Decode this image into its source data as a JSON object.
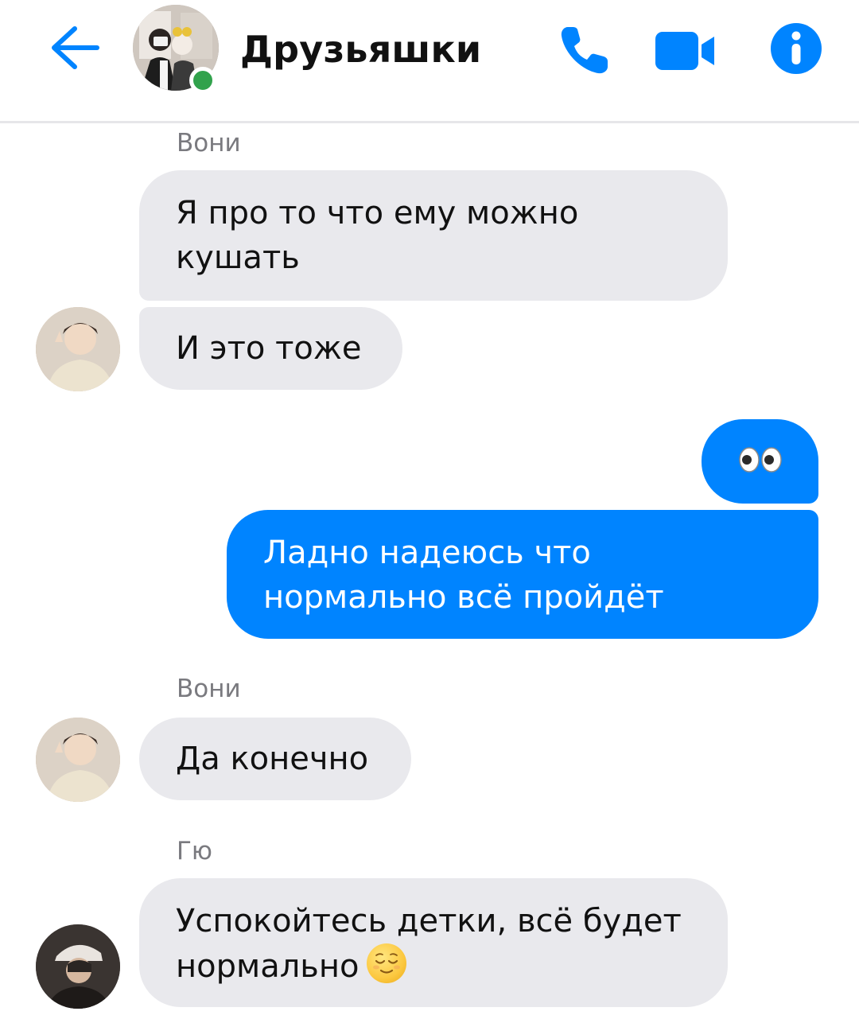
{
  "header": {
    "title": "Друзьяшки",
    "back_icon": "arrow-left-icon",
    "phone_icon": "phone-icon",
    "video_icon": "video-camera-icon",
    "info_icon": "info-icon",
    "accent_color": "#0084ff",
    "online_color": "#31a24c"
  },
  "messages": [
    {
      "sender": "Вони",
      "text_line1": "Я про то что ему можно",
      "text_line2": "кушать",
      "direction": "incoming"
    },
    {
      "sender": "Вони",
      "text": "И это тоже",
      "direction": "incoming"
    },
    {
      "sender": "me",
      "text": "👀",
      "direction": "outgoing"
    },
    {
      "sender": "me",
      "text_line1": "Ладно надеюсь что",
      "text_line2": "нормально всё пройдёт",
      "direction": "outgoing"
    },
    {
      "sender": "Вони",
      "text": "Да конечно",
      "direction": "incoming"
    },
    {
      "sender": "Гю",
      "text_line1": "Успокойтесь детки, всё будет",
      "text_line2": "нормально",
      "emoji": "relieved-face-emoji",
      "direction": "incoming"
    }
  ],
  "colors": {
    "incoming_bubble": "#e9e9ed",
    "outgoing_bubble": "#0084ff"
  }
}
